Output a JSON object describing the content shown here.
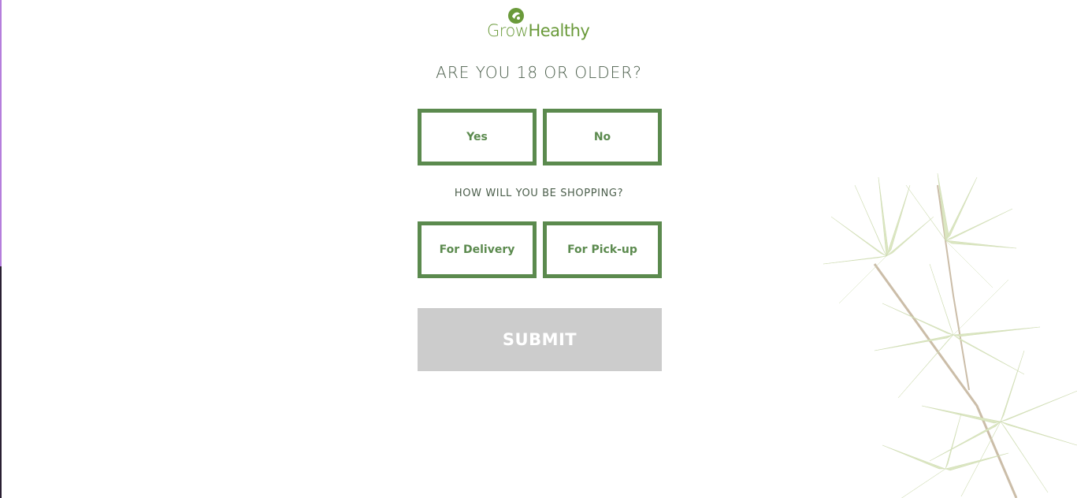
{
  "logo": {
    "text_part1": "Grow",
    "text_part2": "Healthy",
    "icon": "leaf-globe-icon",
    "color": "#6a9a3a"
  },
  "age_question": "ARE YOU 18 OR OLDER?",
  "age_options": {
    "yes": "Yes",
    "no": "No"
  },
  "shopping_question": "HOW WILL YOU BE SHOPPING?",
  "shopping_options": {
    "delivery": "For Delivery",
    "pickup": "For Pick-up"
  },
  "submit_label": "SUBMIT",
  "colors": {
    "accent": "#5b8a4e",
    "text": "#4b5e4b",
    "submit_disabled": "#cccccc",
    "edge_top": "#b57edc",
    "edge_bottom": "#2a1f33"
  },
  "decoration": {
    "background_image": "cannabis-leaves-illustration"
  }
}
